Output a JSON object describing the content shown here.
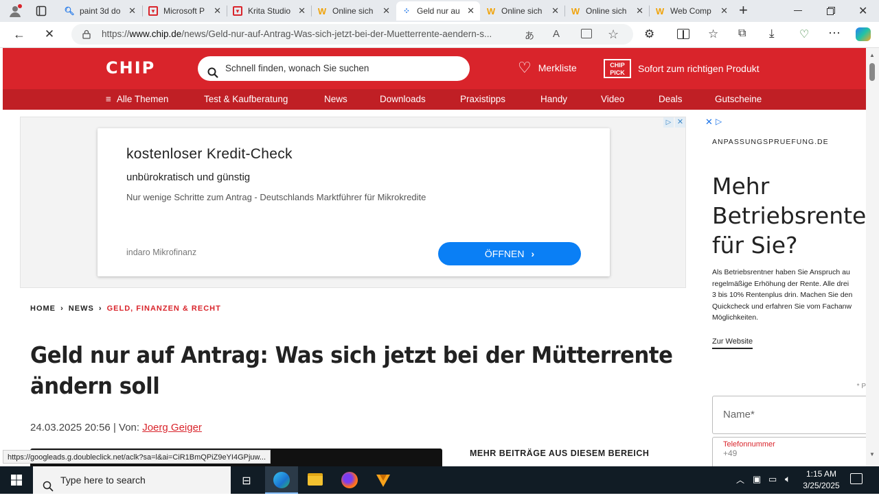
{
  "browser": {
    "tabs": [
      {
        "title": "paint 3d do",
        "icon": "search-icon"
      },
      {
        "title": "Microsoft P",
        "icon": "krita-icon"
      },
      {
        "title": "Krita Studio",
        "icon": "krita-icon"
      },
      {
        "title": "Online sich",
        "icon": "online-icon"
      },
      {
        "title": "Geld nur au",
        "icon": "loading-icon",
        "active": true
      },
      {
        "title": "Online sich",
        "icon": "online-icon"
      },
      {
        "title": "Online sich",
        "icon": "online-icon"
      },
      {
        "title": "Web Comp",
        "icon": "online-icon"
      }
    ],
    "url_prefix": "https://",
    "url_domain": "www.chip.de",
    "url_path": "/news/Geld-nur-auf-Antrag-Was-sich-jetzt-bei-der-Muetterrente-aendern-s...",
    "status_url": "https://googleads.g.doubleclick.net/aclk?sa=l&ai=CiR1BmQPiZ9eYI4GPjuw..."
  },
  "site": {
    "logo": "CHIP",
    "search_placeholder": "Schnell finden, wonach Sie suchen",
    "merkliste": "Merkliste",
    "chip_pick_logo": "CHIP PICK",
    "chip_pick": "Sofort zum richtigen Produkt",
    "nav": [
      "Alle Themen",
      "Test & Kaufberatung",
      "News",
      "Downloads",
      "Praxistipps",
      "Handy",
      "Video",
      "Deals",
      "Gutscheine"
    ],
    "colors": {
      "brand": "#d9242b",
      "nav": "#c01f25",
      "ad_button": "#0a7ff5"
    }
  },
  "ad": {
    "title": "kostenloser Kredit-Check",
    "subtitle": "unbürokratisch und günstig",
    "text": "Nur wenige Schritte zum Antrag - Deutschlands Marktführer für Mikrokredite",
    "advertiser": "indaro Mikrofinanz",
    "button": "ÖFFNEN"
  },
  "article": {
    "breadcrumb": [
      "HOME",
      "NEWS",
      "GELD, FINANZEN & RECHT"
    ],
    "title_line1": "Geld nur auf Antrag: Was sich jetzt bei der Mütterrente",
    "title_line2": "ändern soll",
    "date": "24.03.2025 20:56",
    "by": "| Von:",
    "author": "Joerg Geiger",
    "more_heading": "MEHR BEITRÄGE AUS DIESEM BEREICH"
  },
  "side_ad": {
    "domain": "ANPASSUNGSPRUEFUNG.DE",
    "heading_lines": [
      "Mehr",
      "Betriebsrente",
      "für Sie?"
    ],
    "body_lines": [
      "Als Betriebsrentner haben Sie Anspruch au",
      "regelmäßige Erhöhung der Rente. Alle drei",
      "3 bis 10% Rentenplus drin. Machen Sie den",
      "Quickcheck und erfahren Sie vom Fachanw",
      "Möglichkeiten."
    ],
    "link": "Zur Website",
    "required_note": "* P",
    "name_placeholder": "Name*",
    "phone_placeholder": "Telefonnummer",
    "phone_value": "+49"
  },
  "taskbar": {
    "search_placeholder": "Type here to search",
    "time": "1:15 AM",
    "date": "3/25/2025"
  }
}
